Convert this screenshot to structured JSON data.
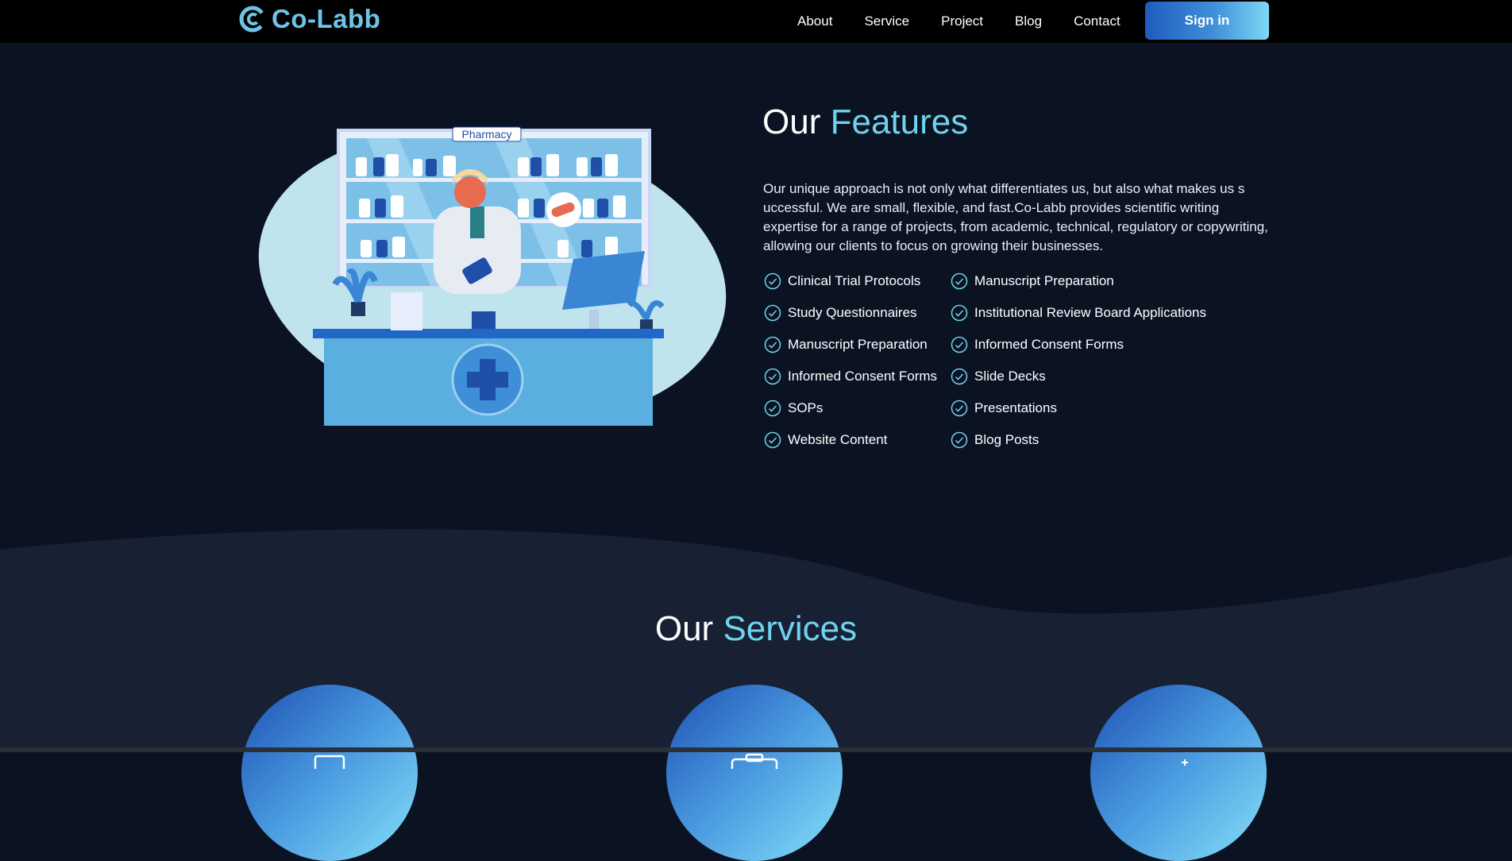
{
  "brand": {
    "name": "Co-Labb",
    "color": "#6ec4e8"
  },
  "nav": {
    "links": [
      "About",
      "Service",
      "Project",
      "Blog",
      "Contact"
    ],
    "signin_label": "Sign in"
  },
  "features": {
    "title_plain": "Our",
    "title_accent": "Features",
    "description": "Our unique approach is not only what differentiates us, but also what makes us s uccessful. We are small, flexible, and fast.Co-Labb provides scientific writing expertise for a range of projects, from academic, technical, regulatory or copywriting, allowing our clients to focus on growing their businesses.",
    "left_items": [
      "Clinical Trial Protocols",
      "Study Questionnaires",
      "Manuscript Preparation",
      "Informed Consent Forms",
      "SOPs",
      "Website Content"
    ],
    "right_items": [
      "Manuscript Preparation",
      "Institutional Review Board Applications",
      "Informed Consent Forms",
      "Slide Decks",
      "Presentations",
      "Blog Posts"
    ],
    "illustration": {
      "sign_text": "Pharmacy"
    }
  },
  "services": {
    "title_plain": "Our",
    "title_accent": "Services",
    "cards": [
      {
        "icon": "laptop-icon"
      },
      {
        "icon": "briefcase-icon"
      },
      {
        "icon": "sparkle-icon"
      }
    ]
  },
  "colors": {
    "background": "#0b1323",
    "accent": "#6fd3ee",
    "wave": "#182033",
    "button_gradient_start": "#1e5bbf",
    "button_gradient_end": "#7fd8f4"
  }
}
